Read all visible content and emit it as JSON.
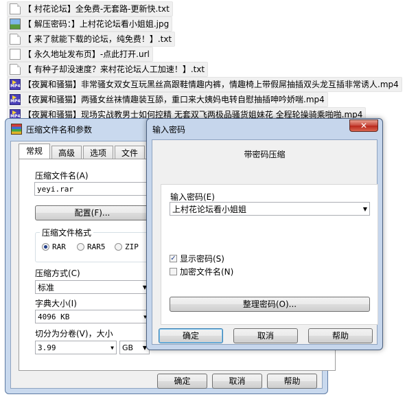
{
  "files": [
    {
      "icon": "txt-file-icon",
      "name": "【 村花论坛】全免费-无套路-更新快.txt"
    },
    {
      "icon": "image-file-icon",
      "name": "【 解压密码：】上村花论坛看小姐姐.jpg"
    },
    {
      "icon": "txt-file-icon",
      "name": "【 来了就能下载的论坛，纯免费！】.txt"
    },
    {
      "icon": "url-file-icon",
      "name": "【 永久地址发布页】-点此打开.url"
    },
    {
      "icon": "txt-file-icon",
      "name": "【 有种子却没速度？来村花论坛人工加速！】.txt"
    },
    {
      "icon": "mp4-file-icon",
      "name": "【夜翼和骚猫】非常骚女双女互玩黑丝高跟鞋情趣内裤，情趣椅上带假屌抽插双头龙互插非常诱人.mp4"
    },
    {
      "icon": "mp4-file-icon",
      "name": "【夜翼和骚猫】两骚女丝袜情趣装互舔，重口来大姨妈电转自慰抽插呻吟娇喘.mp4"
    },
    {
      "icon": "mp4-file-icon",
      "name": "【夜翼和骚猫】现场实战教男士如何控精 无套双飞两极品骚货姐妹花 全程轮操骑乘啪啪.mp4"
    }
  ],
  "mp4_badge": "MP4",
  "archive_dialog": {
    "title": "压缩文件名和参数",
    "tabs": [
      "常规",
      "高级",
      "选项",
      "文件"
    ],
    "archive_name_label": "压缩文件名(A)",
    "archive_name_value": "yeyi.rar",
    "configure_button": "配置(F)...",
    "format_label": "压缩文件格式",
    "formats": [
      "RAR",
      "RAR5",
      "ZIP"
    ],
    "selected_format": "RAR",
    "method_label": "压缩方式(C)",
    "method_value": "标准",
    "dict_label": "字典大小(I)",
    "dict_value": "4096 KB",
    "split_label": "切分为分卷(V)，大小",
    "split_value": "3.99",
    "split_unit": "GB",
    "ok_button": "确定",
    "cancel_button": "取消",
    "help_button": "帮助"
  },
  "password_dialog": {
    "title": "输入密码",
    "close_symbol": "✕",
    "subtitle": "带密码压缩",
    "password_label": "输入密码(E)",
    "password_value": "上村花论坛看小姐姐",
    "show_password_label": "显示密码(S)",
    "show_password_checked": true,
    "encrypt_names_label": "加密文件名(N)",
    "encrypt_names_checked": false,
    "organize_button": "整理密码(O)...",
    "ok_button": "确定",
    "cancel_button": "取消",
    "help_button": "帮助"
  }
}
